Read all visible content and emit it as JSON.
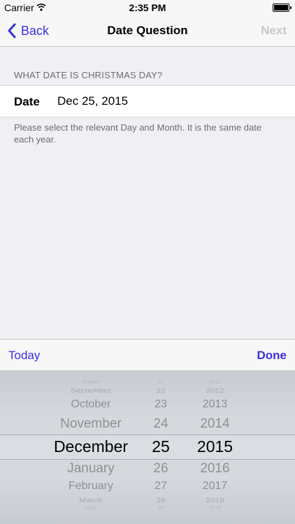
{
  "status_bar": {
    "carrier": "Carrier",
    "time": "2:35 PM"
  },
  "nav": {
    "back_label": "Back",
    "title": "Date Question",
    "next_label": "Next"
  },
  "question": {
    "header": "WHAT DATE IS CHRISTMAS DAY?",
    "field_label": "Date",
    "field_value": "Dec 25, 2015",
    "footer": "Please select the relevant Day and Month. It is the same date each year."
  },
  "toolbar": {
    "today_label": "Today",
    "done_label": "Done"
  },
  "picker": {
    "months": [
      "August",
      "September",
      "October",
      "November",
      "December",
      "January",
      "February",
      "March",
      "April"
    ],
    "days": [
      "21",
      "22",
      "23",
      "24",
      "25",
      "26",
      "27",
      "28",
      "29"
    ],
    "years": [
      "2011",
      "2012",
      "2013",
      "2014",
      "2015",
      "2016",
      "2017",
      "2018",
      "2019"
    ],
    "selected_index": 4
  },
  "colors": {
    "accent": "#3b2fe0",
    "disabled": "#c7c7cc",
    "background": "#efeff4"
  }
}
